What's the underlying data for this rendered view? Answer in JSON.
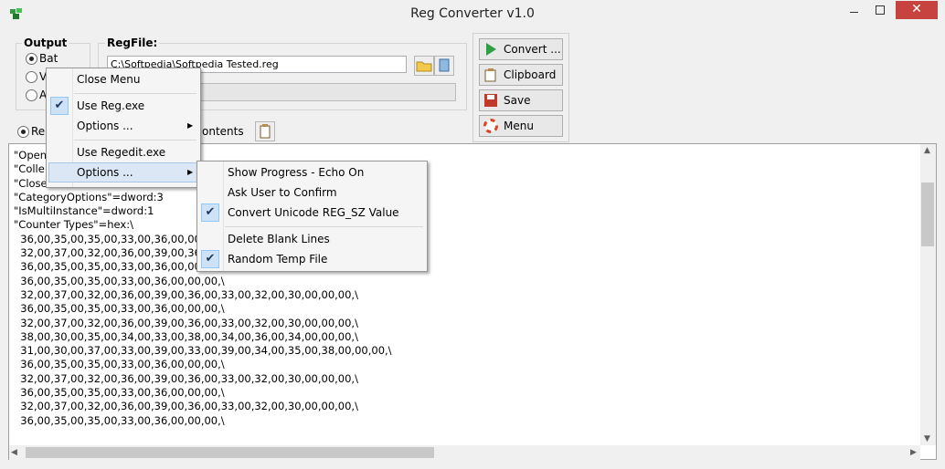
{
  "window": {
    "title": "Reg Converter v1.0",
    "close_glyph": "✕"
  },
  "output": {
    "label": "Output",
    "options": [
      {
        "label": "Bat",
        "selected": true
      },
      {
        "label": "V",
        "selected": false
      },
      {
        "label": "A",
        "selected": false
      }
    ]
  },
  "regfile": {
    "label": "RegFile:",
    "path": "C:\\Softpedia\\Softpedia Tested.reg"
  },
  "bottom_row": {
    "radio_label": "Re",
    "contents_label": "ontents"
  },
  "buttons": {
    "convert": "Convert ...",
    "clipboard": "Clipboard ...",
    "save": "Save",
    "menu": "Menu"
  },
  "text_lines": [
    "\"Open",
    "\"Colle",
    "\"Close\"=\"ClosePerformanceData\"",
    "\"CategoryOptions\"=dword:3",
    "\"IsMultiInstance\"=dword:1",
    "\"Counter Types\"=hex:\\",
    "  36,00,35,00,35,00,33,00,36,00,00,",
    "  32,00,37,00,32,00,36,00,39,00,36",
    "  36,00,35,00,35,00,33,00,36,00,00,00,\\",
    "  36,00,35,00,35,00,33,00,36,00,00,00,\\",
    "  32,00,37,00,32,00,36,00,39,00,36,00,33,00,32,00,30,00,00,00,\\",
    "  36,00,35,00,35,00,33,00,36,00,00,00,\\",
    "  32,00,37,00,32,00,36,00,39,00,36,00,33,00,32,00,30,00,00,00,\\",
    "  38,00,30,00,35,00,34,00,33,00,38,00,34,00,36,00,34,00,00,00,\\",
    "  31,00,30,00,37,00,33,00,39,00,33,00,39,00,34,00,35,00,38,00,00,00,\\",
    "  36,00,35,00,35,00,33,00,36,00,00,00,\\",
    "  32,00,37,00,32,00,36,00,39,00,36,00,33,00,32,00,30,00,00,00,\\",
    "  36,00,35,00,35,00,33,00,36,00,00,00,\\",
    "  32,00,37,00,32,00,36,00,39,00,36,00,33,00,32,00,30,00,00,00,\\",
    "  36,00,35,00,35,00,33,00,36,00,00,00,\\"
  ],
  "menu1": {
    "close_menu": "Close Menu",
    "use_reg": "Use Reg.exe",
    "options1": "Options ...",
    "use_regedit": "Use Regedit.exe",
    "options2": "Options ...",
    "arrow": "▶",
    "check": "✔"
  },
  "menu2": {
    "show_progress": "Show Progress - Echo On",
    "ask_user": "Ask User to Confirm",
    "convert_unicode": "Convert Unicode REG_SZ Value",
    "delete_blank": "Delete Blank Lines",
    "random_temp": "Random Temp File"
  },
  "colors": {
    "accent_check": "#cde2f7",
    "close_button": "#c7433f"
  }
}
